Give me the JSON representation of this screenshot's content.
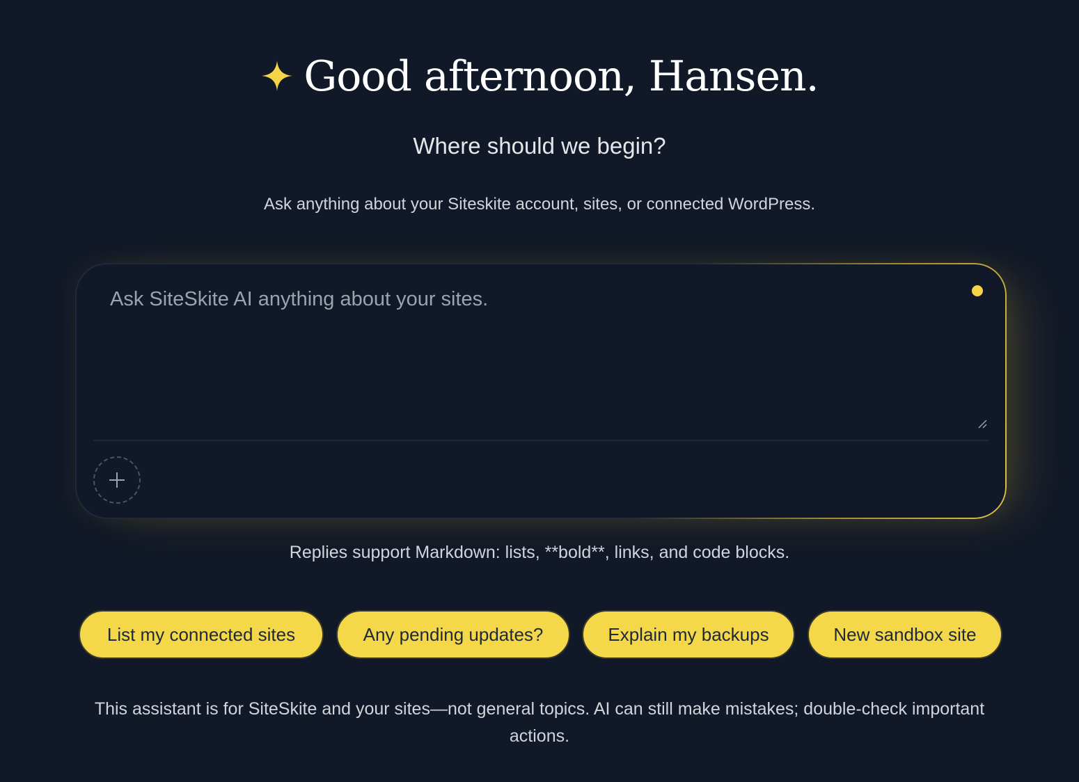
{
  "greeting": {
    "text": "Good afternoon, Hansen.",
    "icon": "sparkle-icon",
    "icon_color": "#F5D547"
  },
  "subtitle": "Where should we begin?",
  "lede": "Ask anything about your Siteskite account, sites, or connected WordPress.",
  "composer": {
    "placeholder": "Ask SiteSkite AI anything about your sites.",
    "value": "",
    "status_color": "#F5D547",
    "attach_icon": "plus-icon"
  },
  "hint": "Replies support Markdown: lists, **bold**, links, and code blocks.",
  "suggestions": [
    {
      "label": "List my connected sites"
    },
    {
      "label": "Any pending updates?"
    },
    {
      "label": "Explain my backups"
    },
    {
      "label": "New sandbox site"
    }
  ],
  "disclaimer": "This assistant is for SiteSkite and your sites—not general topics. AI can still make mistakes; double-check important actions.",
  "colors": {
    "background": "#111827",
    "accent": "#F5D84A",
    "text_muted": "#9CA3AF"
  }
}
